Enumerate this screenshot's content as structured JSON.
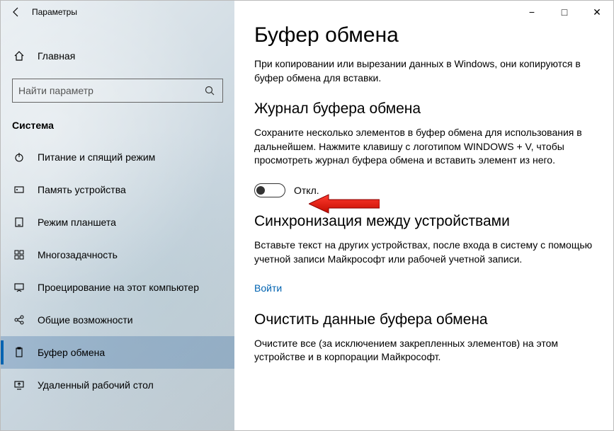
{
  "window": {
    "title": "Параметры",
    "controls": {
      "min": "−",
      "max": "□",
      "close": "✕"
    }
  },
  "sidebar": {
    "home": "Главная",
    "search_placeholder": "Найти параметр",
    "category": "Система",
    "items": [
      {
        "label": "Питание и спящий режим",
        "id": "power"
      },
      {
        "label": "Память устройства",
        "id": "storage"
      },
      {
        "label": "Режим планшета",
        "id": "tablet"
      },
      {
        "label": "Многозадачность",
        "id": "multitask"
      },
      {
        "label": "Проецирование на этот компьютер",
        "id": "projecting"
      },
      {
        "label": "Общие возможности",
        "id": "shared"
      },
      {
        "label": "Буфер обмена",
        "id": "clipboard",
        "selected": true
      },
      {
        "label": "Удаленный рабочий стол",
        "id": "remote"
      }
    ]
  },
  "main": {
    "title": "Буфер обмена",
    "intro": "При копировании или вырезании данных в Windows, они копируются в буфер обмена для вставки.",
    "sections": {
      "history": {
        "heading": "Журнал буфера обмена",
        "desc": "Сохраните несколько элементов в буфер обмена для использования в дальнейшем. Нажмите клавишу с логотипом WINDOWS + V, чтобы просмотреть журнал буфера обмена и вставить элемент из него.",
        "toggle_state": "Откл."
      },
      "sync": {
        "heading": "Синхронизация между устройствами",
        "desc": "Вставьте текст на других устройствах, после входа в систему с помощью учетной записи Майкрософт или рабочей учетной записи.",
        "link": "Войти"
      },
      "clear": {
        "heading": "Очистить данные буфера обмена",
        "desc": "Очистите все (за исключением закрепленных элементов) на этом устройстве и в корпорации Майкрософт."
      }
    }
  }
}
